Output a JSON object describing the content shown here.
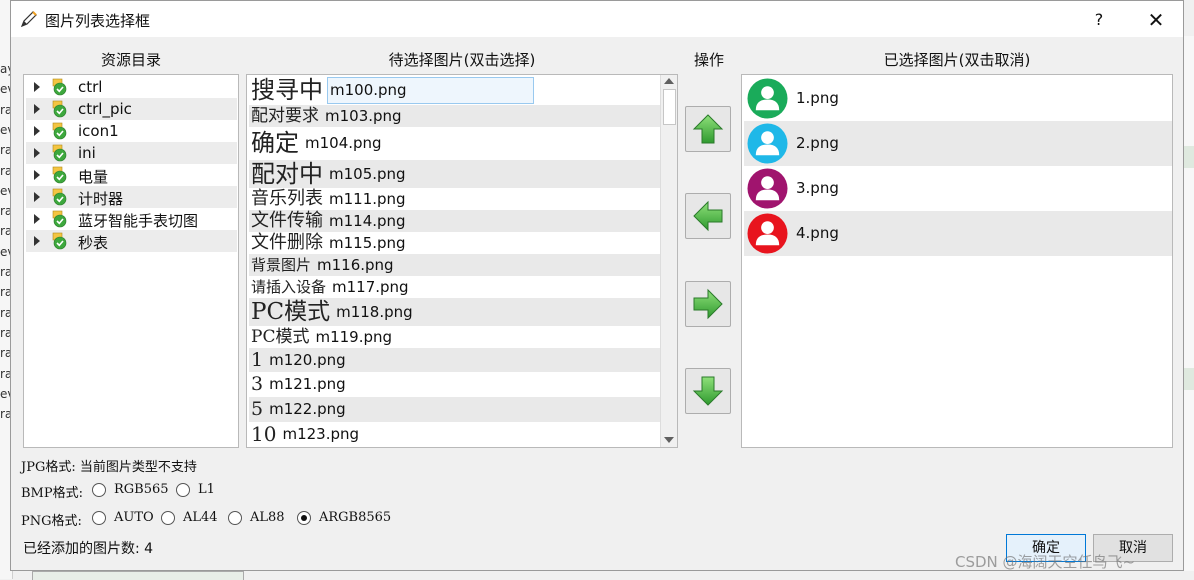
{
  "window": {
    "title": "图片列表选择框",
    "help_label": "?",
    "close_label": "✕"
  },
  "headers": {
    "resources": "资源目录",
    "pending": "待选择图片(双击选择)",
    "operations": "操作",
    "selected": "已选择图片(双击取消)"
  },
  "tree": {
    "items": [
      {
        "label": "ctrl"
      },
      {
        "label": "ctrl_pic"
      },
      {
        "label": "icon1"
      },
      {
        "label": "ini"
      },
      {
        "label": "电量"
      },
      {
        "label": "计时器"
      },
      {
        "label": "蓝牙智能手表切图"
      },
      {
        "label": "秒表"
      }
    ]
  },
  "pending_list": {
    "items": [
      {
        "preview": "搜寻中",
        "file": "m100.png"
      },
      {
        "preview": "配对要求",
        "file": "m103.png"
      },
      {
        "preview": "确定",
        "file": "m104.png"
      },
      {
        "preview": "配对中",
        "file": "m105.png"
      },
      {
        "preview": "音乐列表",
        "file": "m111.png"
      },
      {
        "preview": "文件传输",
        "file": "m114.png"
      },
      {
        "preview": "文件删除",
        "file": "m115.png"
      },
      {
        "preview": "背景图片",
        "file": "m116.png"
      },
      {
        "preview": "请插入设备",
        "file": "m117.png"
      },
      {
        "preview": "PC模式",
        "file": "m118.png"
      },
      {
        "preview": "PC模式",
        "file": "m119.png"
      },
      {
        "preview": "1",
        "file": "m120.png"
      },
      {
        "preview": "3",
        "file": "m121.png"
      },
      {
        "preview": "5",
        "file": "m122.png"
      },
      {
        "preview": "10",
        "file": "m123.png"
      }
    ]
  },
  "operations": {
    "icons": [
      "arrow-up-icon",
      "arrow-left-icon",
      "arrow-right-icon",
      "arrow-down-icon"
    ]
  },
  "selected_list": {
    "items": [
      {
        "label": "1.png",
        "color": "#1aab5a"
      },
      {
        "label": "2.png",
        "color": "#1fb8e8"
      },
      {
        "label": "3.png",
        "color": "#a0146e"
      },
      {
        "label": "4.png",
        "color": "#e8141e"
      }
    ]
  },
  "options": {
    "jpg_text": "JPG格式: 当前图片类型不支持",
    "bmp_label": "BMP格式:",
    "bmp_options": [
      {
        "label": "RGB565",
        "checked": false
      },
      {
        "label": "L1",
        "checked": false
      }
    ],
    "png_label": "PNG格式:",
    "png_options": [
      {
        "label": "AUTO",
        "checked": false
      },
      {
        "label": "AL44",
        "checked": false
      },
      {
        "label": "AL88",
        "checked": false
      },
      {
        "label": "ARGB8565",
        "checked": true
      }
    ]
  },
  "footer": {
    "count_text": "已经添加的图片数: 4",
    "ok_label": "确定",
    "cancel_label": "取消",
    "watermark": "CSDN @海阔天空任鸟飞~"
  },
  "background_fragments": [
    "ay",
    "ev",
    "ra",
    "ev",
    "ra",
    "ra",
    "ev",
    "ra",
    "ra",
    "ev",
    "ra",
    "ra",
    "ra",
    "ra",
    "ra",
    "ra",
    "ev",
    "ra"
  ],
  "colors": {
    "accent": "#0078d7",
    "arrow_green": "#3aa83a"
  }
}
